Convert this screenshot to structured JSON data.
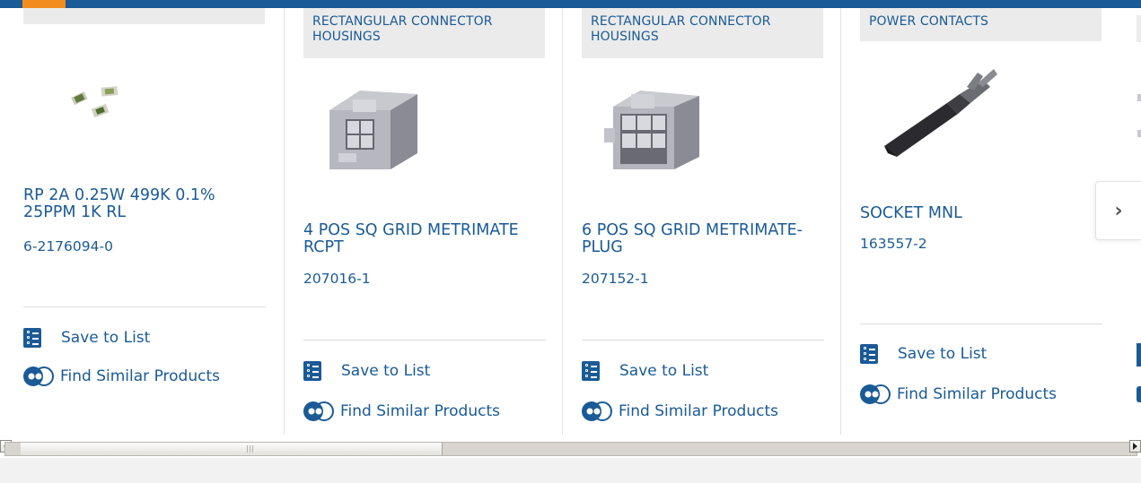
{
  "products": [
    {
      "category": "",
      "name": "RP 2A 0.25W 499K 0.1% 25PPM 1K RL",
      "part_number": "6-2176094-0",
      "save_label": "Save to List",
      "similar_label": "Find Similar Products",
      "image": "smd-resistor-chips"
    },
    {
      "category": "RECTANGULAR CONNECTOR HOUSINGS",
      "name": "4 POS SQ GRID METRIMATE RCPT",
      "part_number": "207016-1",
      "save_label": "Save to List",
      "similar_label": "Find Similar Products",
      "image": "connector-housing-4pos"
    },
    {
      "category": "RECTANGULAR CONNECTOR HOUSINGS",
      "name": "6 POS SQ GRID METRIMATE-PLUG",
      "part_number": "207152-1",
      "save_label": "Save to List",
      "similar_label": "Find Similar Products",
      "image": "connector-housing-6pos"
    },
    {
      "category": "POWER CONTACTS",
      "name": "SOCKET MNL",
      "part_number": "163557-2",
      "save_label": "Save to List",
      "similar_label": "Find Similar Products",
      "image": "socket-contact"
    }
  ],
  "carousel": {
    "next_icon": "chevron-right-icon",
    "next_glyph": "›"
  },
  "colors": {
    "brand_blue": "#1a5a96",
    "accent_orange": "#f28c1e",
    "tag_bg": "#ebebeb"
  }
}
